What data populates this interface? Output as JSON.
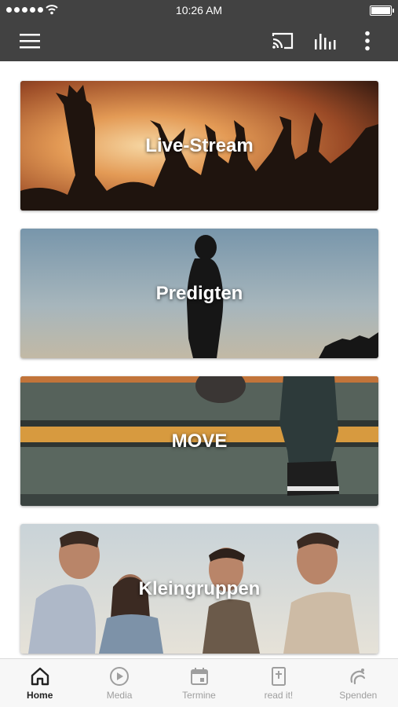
{
  "status_bar": {
    "time": "10:26 AM"
  },
  "app_bar": {
    "icons": [
      "menu-icon",
      "cast-icon",
      "equalizer-icon",
      "more-vert-icon"
    ]
  },
  "cards": [
    {
      "label": "Live-Stream"
    },
    {
      "label": "Predigten"
    },
    {
      "label": "MOVE"
    },
    {
      "label": "Kleingruppen"
    }
  ],
  "bottom_nav": {
    "tabs": [
      {
        "label": "Home",
        "icon": "home-icon",
        "active": true
      },
      {
        "label": "Media",
        "icon": "play-circle-icon"
      },
      {
        "label": "Termine",
        "icon": "calendar-icon"
      },
      {
        "label": "read it!",
        "icon": "bible-icon"
      },
      {
        "label": "Spenden",
        "icon": "donate-icon"
      }
    ]
  },
  "colors": {
    "bar": "#424242",
    "active_tab": "#222222",
    "inactive_tab": "#9e9e9e"
  }
}
